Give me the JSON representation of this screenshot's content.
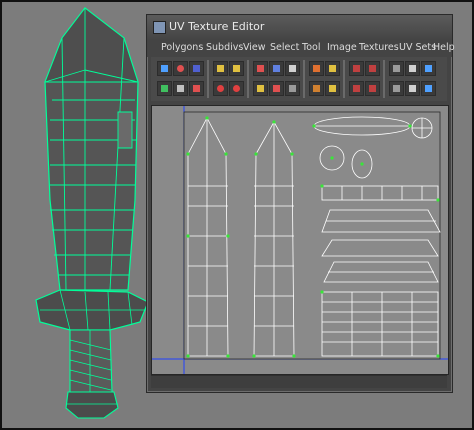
{
  "uv_editor": {
    "title": "UV Texture Editor",
    "menu": [
      "Polygons",
      "Subdivs",
      "View",
      "Select",
      "Tool",
      "Image",
      "Textures",
      "UV Sets",
      "Help"
    ]
  },
  "colors": {
    "wireframe_selected": "#39e639",
    "uv_edges": "#ffffff",
    "viewport_bg": "#7c7c7c",
    "uv_bg": "#8a8a8a",
    "mesh_wire": "#00ff99"
  }
}
